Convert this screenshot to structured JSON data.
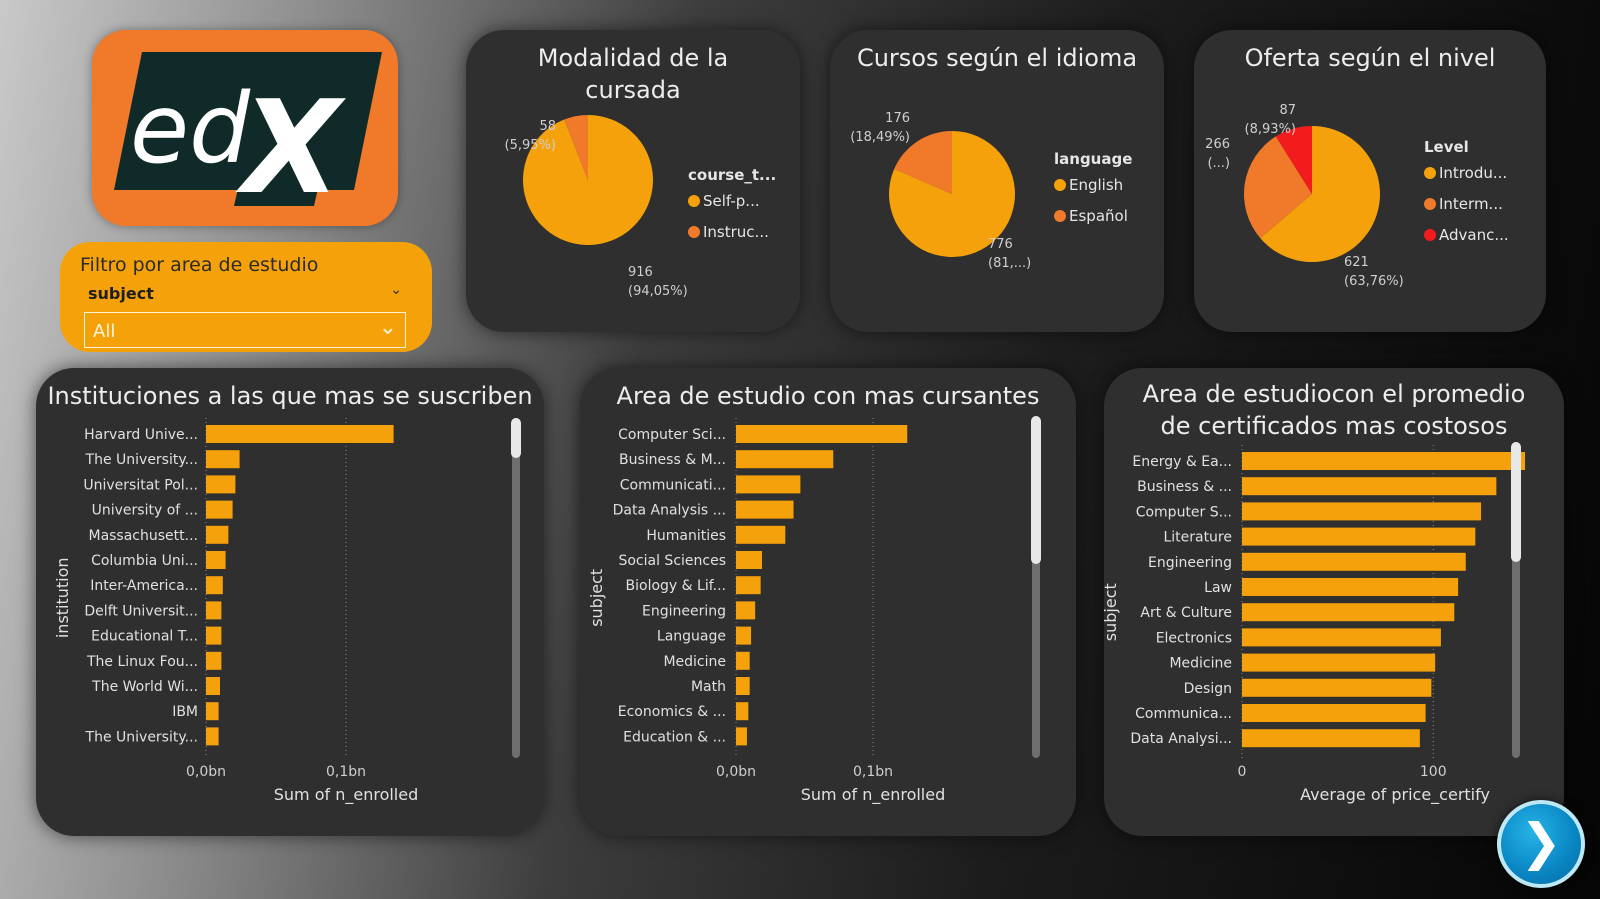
{
  "logo": {
    "text": "edX"
  },
  "filter": {
    "title": "Filtro por area de estudio",
    "field": "subject",
    "value": "All"
  },
  "colors": {
    "primary": "#f5a10c",
    "secondary": "#f07a2a",
    "tertiary": "#f21c1c",
    "card": "#2f2f2f"
  },
  "chart_data": [
    {
      "type": "pie",
      "title": "Modalidad de la cursada",
      "legend_title": "course_t...",
      "legend_position": "right",
      "slices": [
        {
          "label": "Self-p...",
          "value": 916,
          "pct_label": "(94,05%)",
          "color": "#f5a10c"
        },
        {
          "label": "Instruc...",
          "value": 58,
          "pct_label": "(5,95%)",
          "color": "#f07a2a"
        }
      ]
    },
    {
      "type": "pie",
      "title": "Cursos según el idioma",
      "legend_title": "language",
      "legend_position": "right",
      "slices": [
        {
          "label": "English",
          "value": 776,
          "pct_label": "(81,...)",
          "color": "#f5a10c"
        },
        {
          "label": "Español",
          "value": 176,
          "pct_label": "(18,49%)",
          "color": "#f07a2a"
        }
      ]
    },
    {
      "type": "pie",
      "title": "Oferta según el nivel",
      "legend_title": "Level",
      "legend_position": "right",
      "slices": [
        {
          "label": "Introdu...",
          "value": 621,
          "pct_label": "(63,76%)",
          "color": "#f5a10c"
        },
        {
          "label": "Interm...",
          "value": 266,
          "pct_label": "(...)",
          "color": "#f07a2a"
        },
        {
          "label": "Advanc...",
          "value": 87,
          "pct_label": "(8,93%)",
          "color": "#f21c1c"
        }
      ]
    },
    {
      "type": "bar",
      "orientation": "horizontal",
      "title": "Instituciones a las que mas se suscriben",
      "xlabel": "Sum of n_enrolled",
      "ylabel": "institution",
      "xlim": [
        0,
        0.2
      ],
      "ticks": [
        {
          "value": 0,
          "label": "0,0bn"
        },
        {
          "value": 0.1,
          "label": "0,1bn"
        }
      ],
      "grid": true,
      "categories": [
        "Harvard Unive...",
        "The University...",
        "Universitat Pol...",
        "University of ...",
        "Massachusett...",
        "Columbia Uni...",
        "Inter-America...",
        "Delft Universit...",
        "Educational T...",
        "The Linux Fou...",
        "The World Wi...",
        "IBM",
        "The University..."
      ],
      "values": [
        0.134,
        0.024,
        0.021,
        0.019,
        0.016,
        0.014,
        0.012,
        0.011,
        0.011,
        0.011,
        0.01,
        0.009,
        0.009
      ]
    },
    {
      "type": "bar",
      "orientation": "horizontal",
      "title": "Area de estudio con mas cursantes",
      "xlabel": "Sum of n_enrolled",
      "ylabel": "subject",
      "xlim": [
        0,
        0.2
      ],
      "ticks": [
        {
          "value": 0,
          "label": "0,0bn"
        },
        {
          "value": 0.1,
          "label": "0,1bn"
        }
      ],
      "grid": true,
      "categories": [
        "Computer Sci...",
        "Business & M...",
        "Communicati...",
        "Data Analysis ...",
        "Humanities",
        "Social Sciences",
        "Biology & Lif...",
        "Engineering",
        "Language",
        "Medicine",
        "Math",
        "Economics & ...",
        "Education & ..."
      ],
      "values": [
        0.125,
        0.071,
        0.047,
        0.042,
        0.036,
        0.019,
        0.018,
        0.014,
        0.011,
        0.01,
        0.01,
        0.009,
        0.008
      ]
    },
    {
      "type": "bar",
      "orientation": "horizontal",
      "title": "Area de estudiocon el promedio de certificados mas costosos",
      "xlabel": "Average of price_certify",
      "ylabel": "subject",
      "xlim": [
        0,
        160
      ],
      "ticks": [
        {
          "value": 0,
          "label": "0"
        },
        {
          "value": 100,
          "label": "100"
        }
      ],
      "grid": true,
      "categories": [
        "Energy & Ea...",
        "Business & ...",
        "Computer S...",
        "Literature",
        "Engineering",
        "Law",
        "Art & Culture",
        "Electronics",
        "Medicine",
        "Design",
        "Communica...",
        "Data Analysi..."
      ],
      "values": [
        148,
        133,
        125,
        122,
        117,
        113,
        111,
        104,
        101,
        99,
        96,
        93
      ]
    }
  ]
}
